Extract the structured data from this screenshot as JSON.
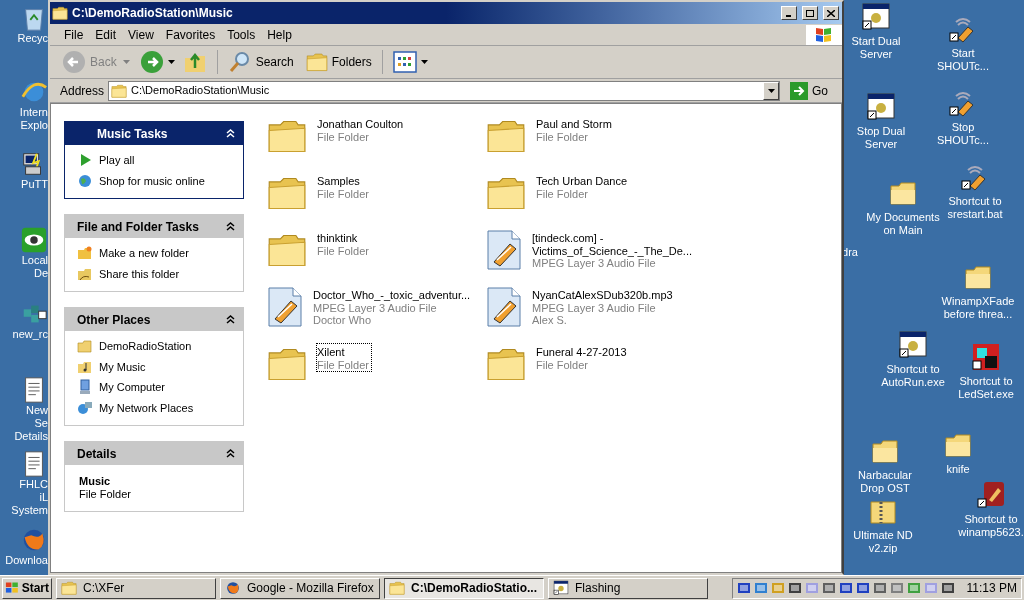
{
  "window": {
    "title": "C:\\DemoRadioStation\\Music"
  },
  "menu": [
    "File",
    "Edit",
    "View",
    "Favorites",
    "Tools",
    "Help"
  ],
  "toolbar": {
    "back": {
      "label": "Back",
      "disabled": true
    },
    "search": "Search",
    "folders": "Folders"
  },
  "address": {
    "label": "Address",
    "value": "C:\\DemoRadioStation\\Music",
    "go": "Go"
  },
  "panels": [
    {
      "title": "Music Tasks",
      "kind": "special",
      "items": [
        {
          "label": "Play all",
          "kind": "play"
        },
        {
          "label": "Shop for music online",
          "kind": "globe"
        }
      ]
    },
    {
      "title": "File and Folder Tasks",
      "kind": "normal",
      "items": [
        {
          "label": "Make a new folder",
          "kind": "newfolder"
        },
        {
          "label": "Share this folder",
          "kind": "share"
        }
      ]
    },
    {
      "title": "Other Places",
      "kind": "normal",
      "items": [
        {
          "label": "DemoRadioStation",
          "kind": "folder"
        },
        {
          "label": "My Music",
          "kind": "music"
        },
        {
          "label": "My Computer",
          "kind": "computer"
        },
        {
          "label": "My Network Places",
          "kind": "network"
        }
      ]
    },
    {
      "title": "Details",
      "kind": "details",
      "name": "Music",
      "type": "File Folder"
    }
  ],
  "files": [
    {
      "kind": "folder",
      "name": "Jonathan Coulton",
      "info": [
        "File Folder"
      ],
      "focused": false
    },
    {
      "kind": "folder",
      "name": "Paul and Storm",
      "info": [
        "File Folder"
      ],
      "focused": false
    },
    {
      "kind": "folder",
      "name": "Samples",
      "info": [
        "File Folder"
      ],
      "focused": false
    },
    {
      "kind": "folder",
      "name": "Tech Urban Dance",
      "info": [
        "File Folder"
      ],
      "focused": false
    },
    {
      "kind": "folder",
      "name": "thinktink",
      "info": [
        "File Folder"
      ],
      "focused": false
    },
    {
      "kind": "audio",
      "name": "[tindeck.com] - Victims_of_Science_-_The_De...",
      "info": [
        "MPEG Layer 3 Audio File"
      ],
      "focused": false
    },
    {
      "kind": "audio",
      "name": "Doctor_Who_-_toxic_adventur...",
      "info": [
        "MPEG Layer 3 Audio File",
        "Doctor Who"
      ],
      "focused": false
    },
    {
      "kind": "audio",
      "name": "NyanCatAlexSDub320b.mp3",
      "info": [
        "MPEG Layer 3 Audio File",
        "Alex S."
      ],
      "focused": false
    },
    {
      "kind": "folder",
      "name": "Xilent",
      "info": [
        "File Folder"
      ],
      "focused": true
    },
    {
      "kind": "folder",
      "name": "Funeral 4-27-2013",
      "info": [
        "File Folder"
      ],
      "focused": false
    }
  ],
  "desktop_left": [
    {
      "kind": "recycle",
      "label": "Recyc"
    },
    {
      "kind": "ie",
      "label": "Intern Explo"
    },
    {
      "kind": "putty",
      "label": "PuTT"
    },
    {
      "kind": "eye",
      "label": "Local De"
    },
    {
      "kind": "reg",
      "label": "new_rc"
    },
    {
      "kind": "doc",
      "label": "New Se Details"
    },
    {
      "kind": "doc",
      "label": "FHLC iL System"
    },
    {
      "kind": "firefox",
      "label": "Downloa"
    }
  ],
  "desktop_right": [
    {
      "kind": "app",
      "label": "Start Dual Server"
    },
    {
      "kind": "shout",
      "label": "Start SHOUTc..."
    },
    {
      "kind": "app",
      "label": "Stop Dual Server"
    },
    {
      "kind": "shout",
      "label": "Stop SHOUTc..."
    },
    {
      "kind": "folder",
      "label": "My Documents on Main"
    },
    {
      "kind": "shout",
      "label": "Shortcut to srestart.bat"
    },
    {
      "kind": "cut",
      "label": "dra"
    },
    {
      "kind": "folder",
      "label": "WinampXFade before threa..."
    },
    {
      "kind": "app",
      "label": "Shortcut to AutoRun.exe"
    },
    {
      "kind": "ledset",
      "label": "Shortcut to LedSet.exe"
    },
    {
      "kind": "folder",
      "label": "Narbacular Drop OST"
    },
    {
      "kind": "folder",
      "label": "knife"
    },
    {
      "kind": "zip",
      "label": "Ultimate ND v2.zip"
    },
    {
      "kind": "winamp",
      "label": "Shortcut to winamp5623."
    }
  ],
  "taskbar": {
    "start": "Start",
    "tasks": [
      {
        "kind": "folder",
        "label": "C:\\XFer",
        "selected": false
      },
      {
        "kind": "firefox",
        "label": "Google - Mozilla Firefox",
        "selected": false
      },
      {
        "kind": "folder",
        "label": "C:\\DemoRadioStatio...",
        "selected": true
      },
      {
        "kind": "app",
        "label": "Flashing",
        "selected": false
      }
    ],
    "clock": "11:13 PM"
  }
}
